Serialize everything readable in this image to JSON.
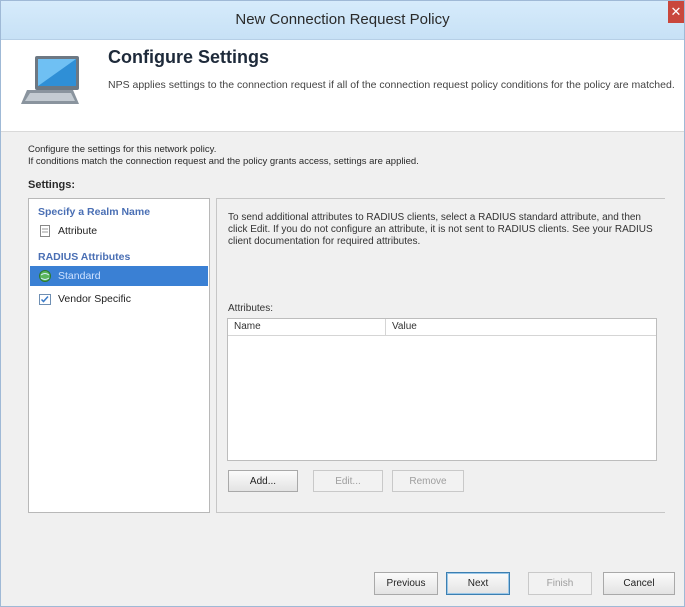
{
  "window": {
    "title": "New Connection Request Policy",
    "close_glyph": "✕"
  },
  "header": {
    "title": "Configure Settings",
    "description": "NPS applies settings to the connection request if all of the connection request policy conditions for the policy are matched."
  },
  "intro": {
    "line1": "Configure the settings for this network policy.",
    "line2": "If conditions match the connection request and the policy grants access, settings are applied."
  },
  "settings": {
    "label": "Settings:",
    "groups": [
      {
        "header": "Specify a Realm Name",
        "items": [
          {
            "label": "Attribute",
            "icon": "document-icon"
          }
        ]
      },
      {
        "header": "RADIUS Attributes",
        "items": [
          {
            "label": "Standard",
            "icon": "globe-icon",
            "selected": true
          },
          {
            "label": "Vendor Specific",
            "icon": "checklist-icon"
          }
        ]
      }
    ]
  },
  "details": {
    "description": "To send additional attributes to RADIUS clients, select a RADIUS standard attribute, and then click Edit. If you do not configure an attribute, it is not sent to RADIUS clients. See your RADIUS client documentation for required attributes.",
    "attributes_label": "Attributes:",
    "columns": [
      "Name",
      "Value"
    ],
    "rows": [],
    "buttons": {
      "add": "Add...",
      "edit": "Edit...",
      "remove": "Remove"
    }
  },
  "footer": {
    "previous": "Previous",
    "next": "Next",
    "finish": "Finish",
    "cancel": "Cancel"
  }
}
